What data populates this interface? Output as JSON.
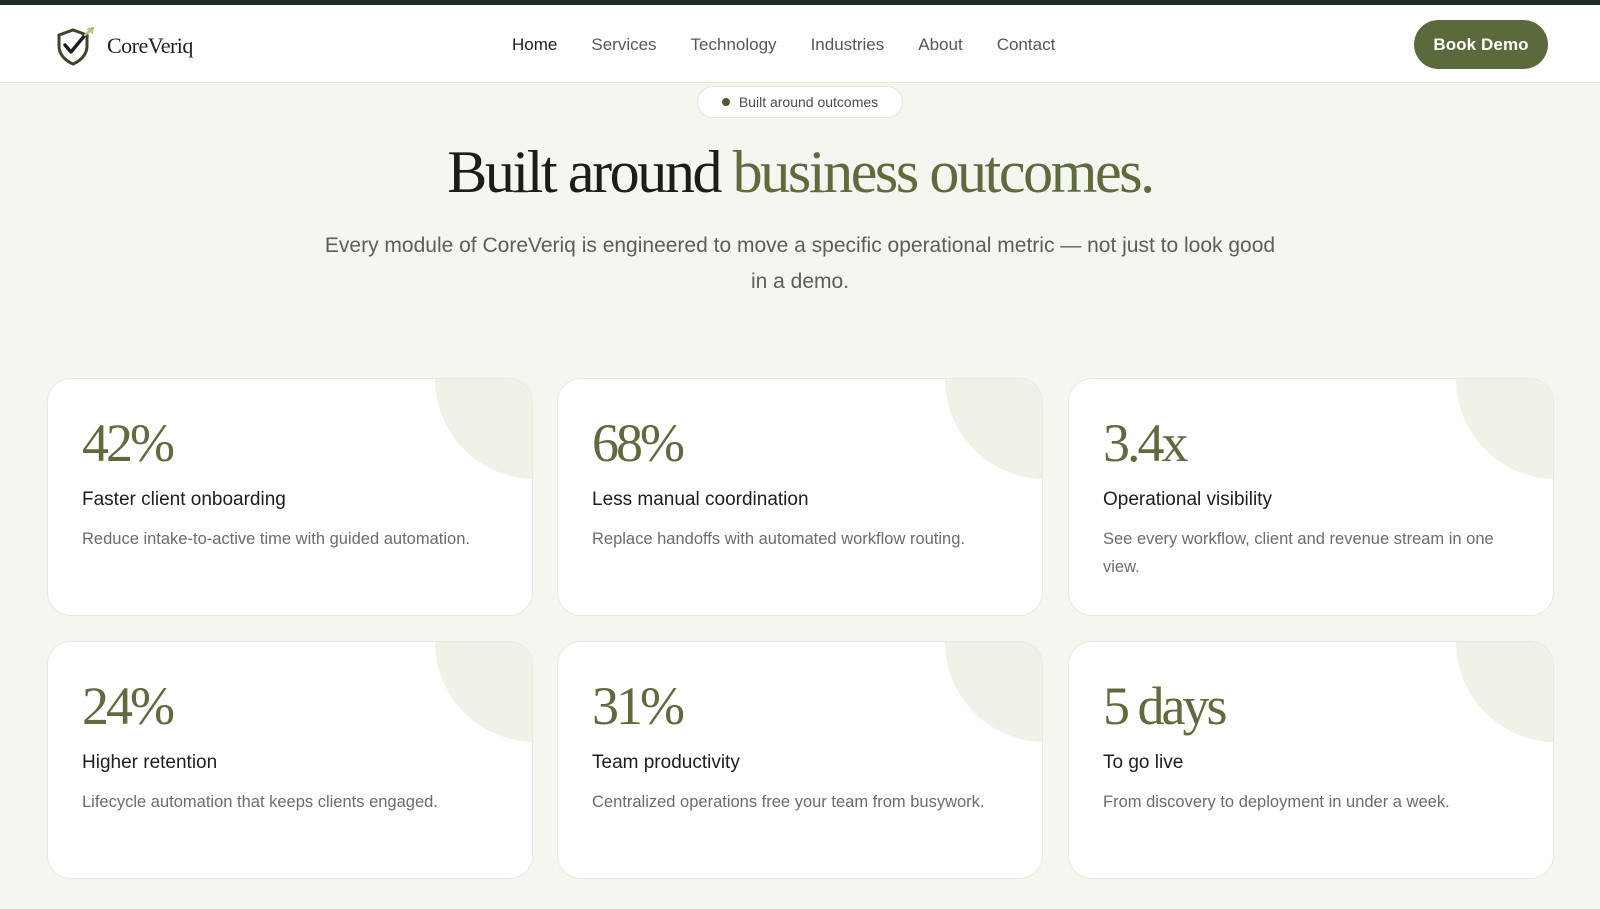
{
  "brand": {
    "name": "CoreVeriq"
  },
  "nav": {
    "items": [
      {
        "label": "Home",
        "active": true
      },
      {
        "label": "Services"
      },
      {
        "label": "Technology"
      },
      {
        "label": "Industries"
      },
      {
        "label": "About"
      },
      {
        "label": "Contact"
      }
    ],
    "cta_label": "Book Demo"
  },
  "hero": {
    "badge": "Built around outcomes",
    "title_main": "Built around",
    "title_accent": "business outcomes.",
    "subtitle": "Every module of CoreVeriq is engineered to move a specific operational metric — not just to look good in a demo."
  },
  "metrics": [
    {
      "value": "42%",
      "title": "Faster client onboarding",
      "desc": "Reduce intake-to-active time with guided automation."
    },
    {
      "value": "68%",
      "title": "Less manual coordination",
      "desc": "Replace handoffs with automated workflow routing."
    },
    {
      "value": "3.4x",
      "title": "Operational visibility",
      "desc": "See every workflow, client and revenue stream in one view."
    },
    {
      "value": "24%",
      "title": "Higher retention",
      "desc": "Lifecycle automation that keeps clients engaged."
    },
    {
      "value": "31%",
      "title": "Team productivity",
      "desc": "Centralized operations free your team from busywork."
    },
    {
      "value": "5 days",
      "title": "To go live",
      "desc": "From discovery to deployment in under a week."
    }
  ],
  "colors": {
    "accent": "#5f6b3e",
    "button": "#5b6a3c",
    "background": "#f5f6f0",
    "top_stripe": "#1e2a28"
  }
}
